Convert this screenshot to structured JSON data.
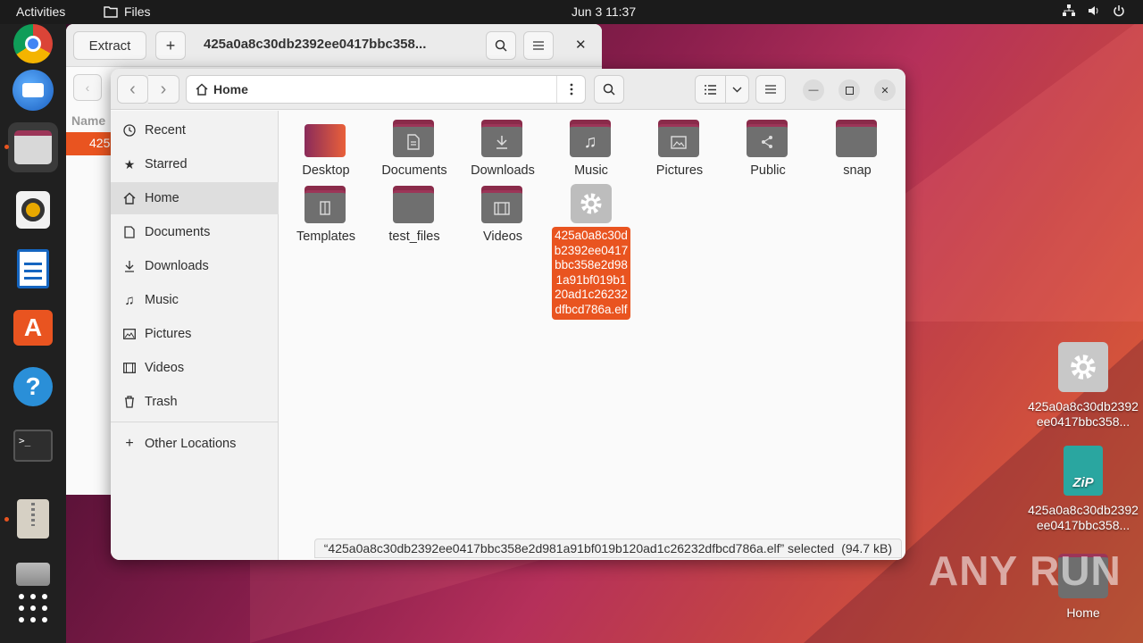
{
  "topbar": {
    "activities": "Activities",
    "app_name": "Files",
    "clock": "Jun 3  11:37"
  },
  "dock": {
    "items": [
      {
        "icon": "chrome-icon"
      },
      {
        "icon": "thunderbird-icon"
      },
      {
        "icon": "files-icon"
      },
      {
        "icon": "rhythmbox-icon"
      },
      {
        "icon": "writer-icon"
      },
      {
        "icon": "app-center-icon"
      },
      {
        "icon": "help-icon"
      },
      {
        "icon": "terminal-icon"
      },
      {
        "icon": "archive-manager-icon"
      },
      {
        "icon": "disk-icon"
      },
      {
        "icon": "app-grid-icon"
      }
    ]
  },
  "archive_window": {
    "extract_label": "Extract",
    "title": "425a0a8c30db2392ee0417bbc358...",
    "column_name": "Name",
    "row_text": "425"
  },
  "files_window": {
    "location": "Home",
    "sidebar": [
      {
        "label": "Recent",
        "icon": "clock-icon"
      },
      {
        "label": "Starred",
        "icon": "star-icon"
      },
      {
        "label": "Home",
        "icon": "home-icon"
      },
      {
        "label": "Documents",
        "icon": "document-icon"
      },
      {
        "label": "Downloads",
        "icon": "download-icon"
      },
      {
        "label": "Music",
        "icon": "music-icon"
      },
      {
        "label": "Pictures",
        "icon": "picture-icon"
      },
      {
        "label": "Videos",
        "icon": "video-icon"
      },
      {
        "label": "Trash",
        "icon": "trash-icon"
      },
      {
        "label": "Other Locations",
        "icon": "plus-icon"
      }
    ],
    "files": [
      {
        "label": "Desktop"
      },
      {
        "label": "Documents"
      },
      {
        "label": "Downloads"
      },
      {
        "label": "Music"
      },
      {
        "label": "Pictures"
      },
      {
        "label": "Public"
      },
      {
        "label": "snap"
      },
      {
        "label": "Templates"
      },
      {
        "label": "test_files"
      },
      {
        "label": "Videos"
      },
      {
        "label": "425a0a8c30db2392ee0417bbc358e2d981a91bf019b120ad1c26232dfbcd786a.elf"
      }
    ],
    "status": {
      "selected": "“425a0a8c30db2392ee0417bbc358e2d981a91bf019b120ad1c26232dfbcd786a.elf” selected",
      "size": "(94.7 kB)"
    }
  },
  "desktop": {
    "icons": [
      {
        "label": "425a0a8c30db2392ee0417bbc358..."
      },
      {
        "label": "425a0a8c30db2392ee0417bbc358..."
      },
      {
        "label": "Home"
      }
    ],
    "watermark": "ANY RUN"
  },
  "colors": {
    "accent": "#e95420",
    "folder_tab": "#9c3558"
  }
}
